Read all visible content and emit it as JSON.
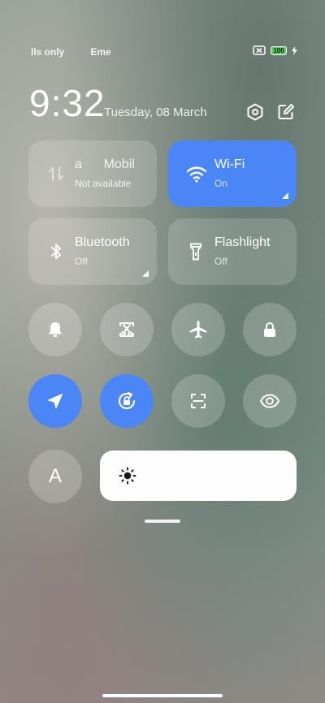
{
  "status": {
    "left_texts": [
      "lls only",
      "Eme"
    ],
    "battery_level": "100"
  },
  "header": {
    "time": "9:32",
    "date": "Tuesday, 08 March"
  },
  "tiles": {
    "mobile": {
      "title": "a      Mobil",
      "subtitle": "Not available"
    },
    "wifi": {
      "title": "Wi-Fi",
      "subtitle": "On"
    },
    "bluetooth": {
      "title": "Bluetooth",
      "subtitle": "Off"
    },
    "flashlight": {
      "title": "Flashlight",
      "subtitle": "Off"
    }
  },
  "toggles": {
    "font_label": "A"
  },
  "colors": {
    "accent": "#4a86f5",
    "tile_bg": "rgba(255,255,255,0.16)",
    "battery_fill": "#57d05c"
  },
  "icons": {
    "header": [
      "settings-icon",
      "edit-icon"
    ],
    "row1": [
      "bell-icon",
      "screenshot-icon",
      "airplane-icon",
      "lock-icon"
    ],
    "row2": [
      "location-icon",
      "rotation-lock-icon",
      "scanner-icon",
      "eye-icon"
    ],
    "row3": [
      "font-icon",
      "sun-icon"
    ]
  }
}
